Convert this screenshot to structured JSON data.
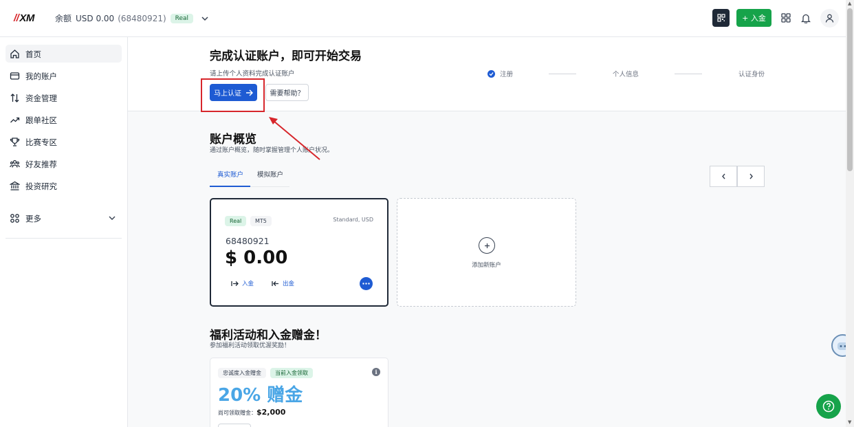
{
  "header": {
    "logo": "XM",
    "balance_label": "余额",
    "balance_value": "USD 0.00",
    "account_id": "(68480921)",
    "account_type": "Real",
    "deposit_label": "+ 入金"
  },
  "sidebar": {
    "items": [
      {
        "label": "首页",
        "icon": "home-icon"
      },
      {
        "label": "我的账户",
        "icon": "wallet-icon"
      },
      {
        "label": "资金管理",
        "icon": "transfer-icon"
      },
      {
        "label": "跟单社区",
        "icon": "trending-up-icon"
      },
      {
        "label": "比赛专区",
        "icon": "trophy-icon"
      },
      {
        "label": "好友推荐",
        "icon": "users-icon"
      },
      {
        "label": "投资研究",
        "icon": "institution-icon"
      }
    ],
    "more_label": "更多"
  },
  "verify": {
    "title": "完成认证账户，即可开始交易",
    "subtitle": "请上传个人资料完成认证账户",
    "verify_button": "马上认证",
    "help_button": "需要帮助？",
    "steps": [
      "注册",
      "个人信息",
      "认证身份"
    ]
  },
  "overview": {
    "title": "账户概览",
    "subtitle": "通过账户概览，随时掌握管理个人账户状况。",
    "tabs": [
      "真实账户",
      "模拟账户"
    ]
  },
  "account_card": {
    "tag_type": "Real",
    "tag_platform": "MT5",
    "plan": "Standard, USD",
    "number": "68480921",
    "balance": "$ 0.00",
    "deposit": "入金",
    "withdraw": "出金"
  },
  "add_account": {
    "label": "添加新账户"
  },
  "promo": {
    "title": "福利活动和入金赠金！",
    "subtitle": "参加福利活动领取优渥奖励！",
    "tag1": "忠诚度入金赠金",
    "tag2": "当前入金领取",
    "headline": "20% 赠金",
    "max_label": "尚可领取赠金：",
    "max_value": "$2,000"
  },
  "colors": {
    "accent": "#1e5bd3",
    "brand_green": "#16a34a",
    "highlight_red": "#d7262b"
  }
}
